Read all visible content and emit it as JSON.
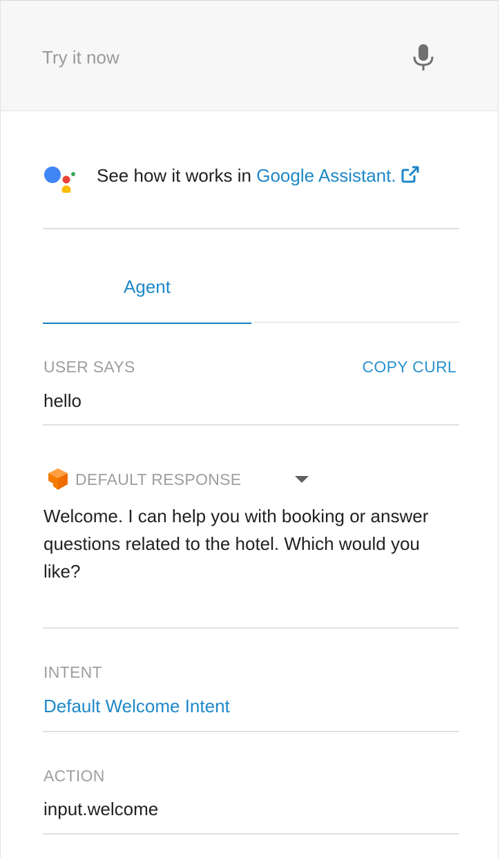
{
  "input": {
    "placeholder": "Try it now"
  },
  "assistant": {
    "prefix": "See how it works in ",
    "link_text": "Google Assistant",
    "suffix": ".",
    "colors": {
      "blue": "#4285F4",
      "red": "#EA4335",
      "yellow": "#FBBC05",
      "green": "#34A853"
    }
  },
  "tabs": [
    {
      "label": "Agent",
      "active": true
    }
  ],
  "user_says": {
    "label": "USER SAYS",
    "copy_curl": "COPY CURL",
    "value": "hello"
  },
  "response": {
    "label": "DEFAULT RESPONSE",
    "text": "Welcome. I can help you with booking or answer questions related to the hotel. Which would you like?"
  },
  "intent": {
    "label": "INTENT",
    "value": "Default Welcome Intent"
  },
  "action": {
    "label": "ACTION",
    "value": "input.welcome"
  },
  "theme": {
    "accent": "#1e88c7",
    "label_gray": "#9e9e9e",
    "text": "#212121"
  }
}
